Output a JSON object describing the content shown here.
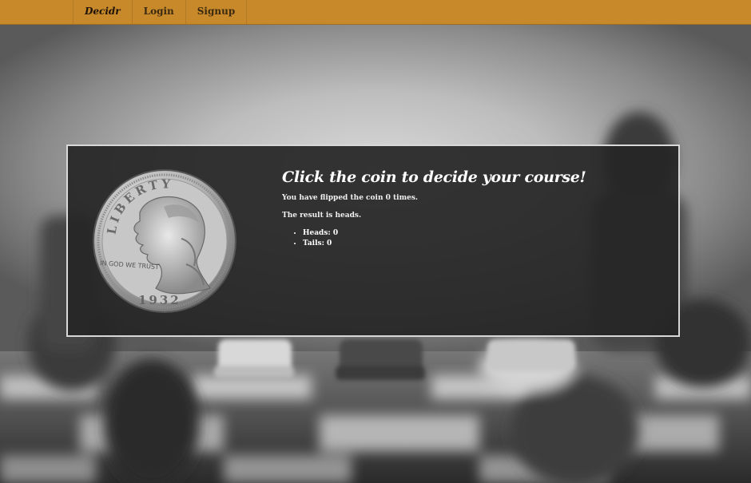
{
  "navbar": {
    "brand": "Decidr",
    "items": [
      "Login",
      "Signup"
    ],
    "bg_color": "#c8892a"
  },
  "panel": {
    "title": "Click the coin to decide your course!",
    "flip_count_text": "You have flipped the coin 0 times.",
    "result_text": "The result is heads.",
    "tally": {
      "heads": "Heads: 0",
      "tails": "Tails: 0"
    }
  },
  "coin": {
    "top_text": "LIBERTY",
    "motto": "IN GOD WE TRUST",
    "year": "1932",
    "icon": "quarter-coin-icon"
  }
}
